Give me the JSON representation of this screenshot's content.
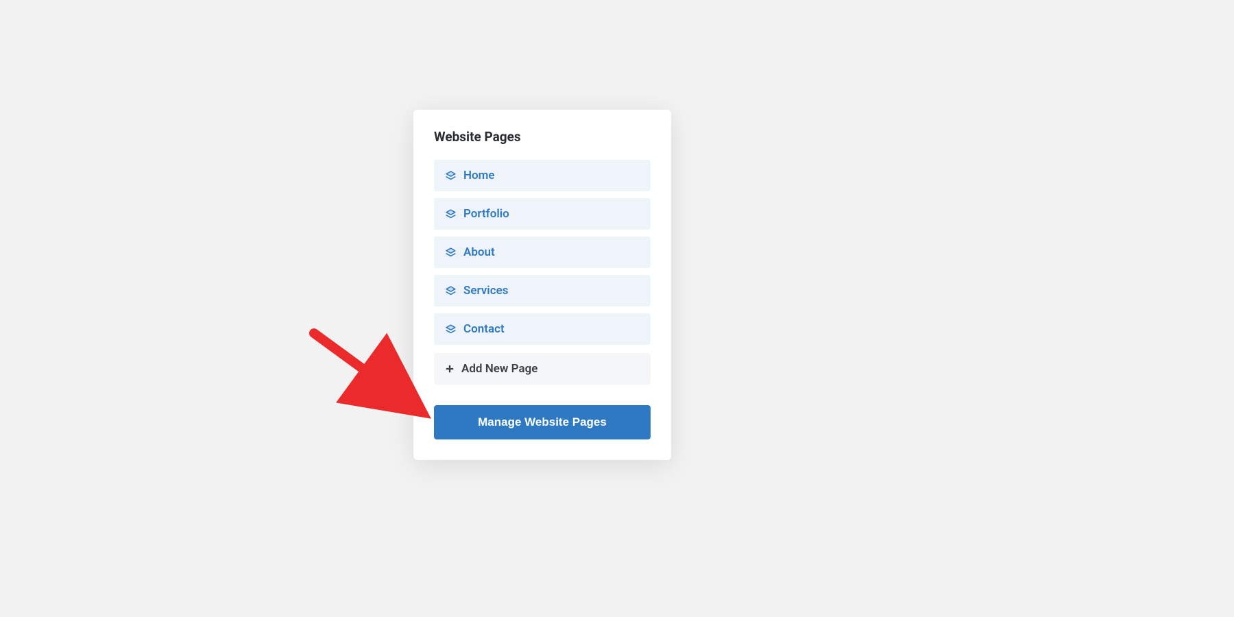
{
  "panel": {
    "title": "Website Pages",
    "pages": [
      {
        "label": "Home"
      },
      {
        "label": "Portfolio"
      },
      {
        "label": "About"
      },
      {
        "label": "Services"
      },
      {
        "label": "Contact"
      }
    ],
    "add_label": "Add New Page",
    "manage_button_label": "Manage Website Pages"
  },
  "colors": {
    "accent": "#2e79c2",
    "panel_bg": "#ffffff",
    "item_bg": "#eef4fa",
    "add_bg": "#f4f6f8",
    "page_bg": "#f2f2f2",
    "arrow": "#eb2b2b"
  }
}
